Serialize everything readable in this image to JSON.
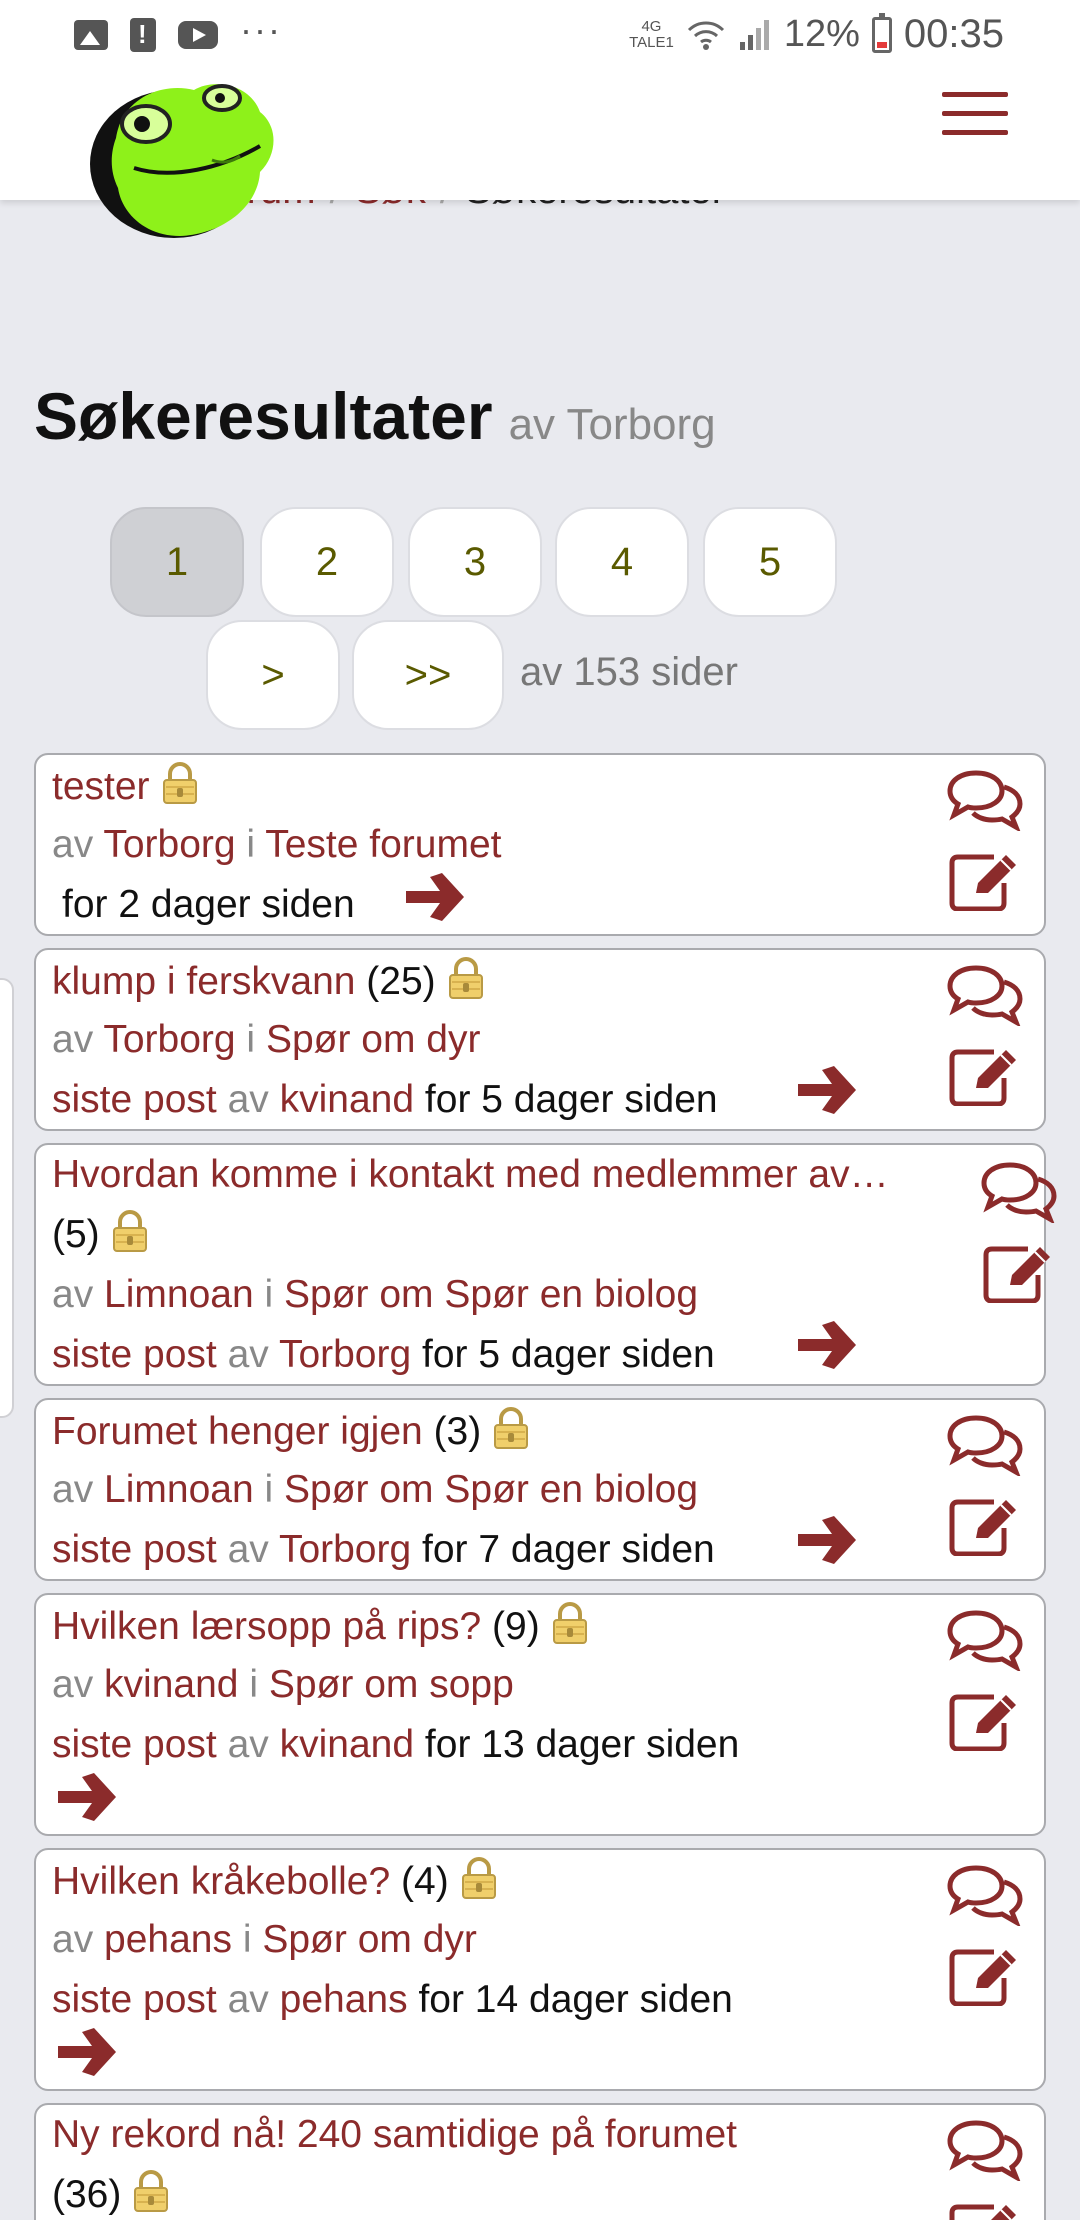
{
  "status_bar": {
    "network_line1": "4G",
    "network_line2": "TALE1",
    "battery": "12%",
    "time": "00:35",
    "more": "···"
  },
  "breadcrumb": {
    "item1": "Forum",
    "item2": "Søk",
    "current": "Søkeresultater"
  },
  "page": {
    "title": "Søkeresultater",
    "author_text": "av Torborg"
  },
  "pagination": {
    "pages": [
      "1",
      "2",
      "3",
      "4",
      "5"
    ],
    "next": ">",
    "last": ">>",
    "total_text": "av 153 sider"
  },
  "labels": {
    "by": "av",
    "in": "i",
    "last_post": "siste post"
  },
  "topics": [
    {
      "title": "tester",
      "count": "",
      "author": "Torborg",
      "forum": "Teste forumet",
      "last_poster": "",
      "time": "for 2 dager siden"
    },
    {
      "title": "klump i ferskvann",
      "count": "(25)",
      "author": "Torborg",
      "forum": "Spør om dyr",
      "last_poster": "kvinand",
      "time": "for 5 dager siden"
    },
    {
      "title": "Hvordan komme i kontakt med medlemmer av…",
      "count": "(5)",
      "author": "Limnoan",
      "forum": "Spør om Spør en biolog",
      "last_poster": "Torborg",
      "time": "for 5 dager siden"
    },
    {
      "title": "Forumet henger igjen",
      "count": "(3)",
      "author": "Limnoan",
      "forum": "Spør om Spør en biolog",
      "last_poster": "Torborg",
      "time": "for 7 dager siden"
    },
    {
      "title": "Hvilken lærsopp på rips?",
      "count": "(9)",
      "author": "kvinand",
      "forum": "Spør om sopp",
      "last_poster": "kvinand",
      "time": "for 13 dager siden"
    },
    {
      "title": "Hvilken kråkebolle?",
      "count": "(4)",
      "author": "pehans",
      "forum": "Spør om dyr",
      "last_poster": "pehans",
      "time": "for 14 dager siden"
    },
    {
      "title": "Ny rekord nå! 240 samtidige på forumet",
      "count": "(36)",
      "author": "",
      "forum": "",
      "last_poster": "",
      "time": ""
    }
  ],
  "colors": {
    "accent": "#8b2b2b",
    "background": "#e9eaef",
    "pager_text": "#5a5a00"
  }
}
